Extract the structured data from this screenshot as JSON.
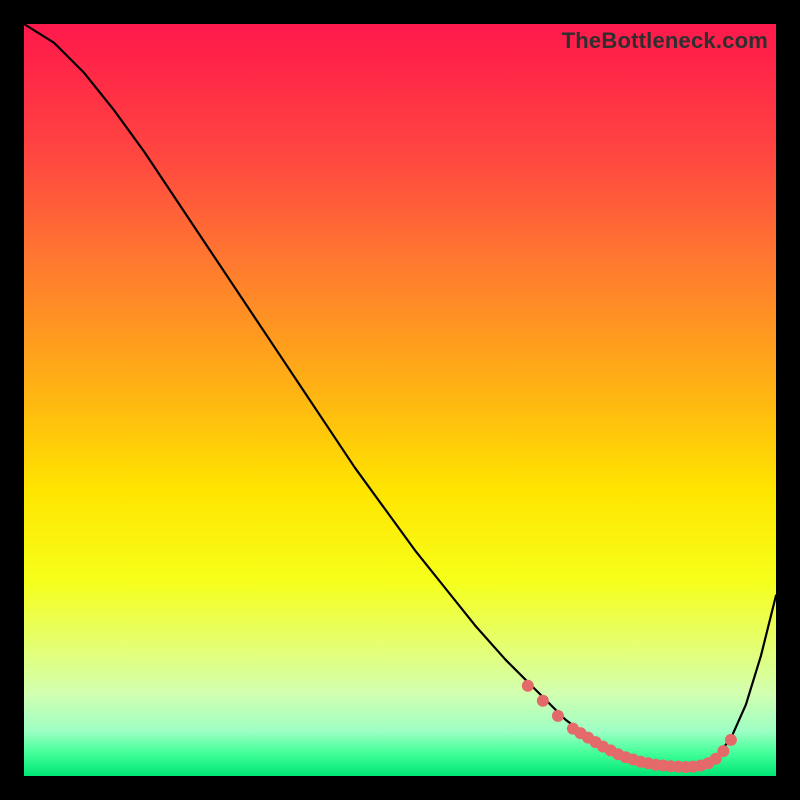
{
  "watermark": "TheBottleneck.com",
  "chart_data": {
    "type": "line",
    "title": "",
    "xlabel": "",
    "ylabel": "",
    "xlim": [
      0,
      100
    ],
    "ylim": [
      0,
      100
    ],
    "series": [
      {
        "name": "curve",
        "x": [
          0,
          4,
          8,
          12,
          16,
          20,
          24,
          28,
          32,
          36,
          40,
          44,
          48,
          52,
          56,
          60,
          64,
          68,
          72,
          74,
          76,
          78,
          80,
          82,
          84,
          86,
          88,
          90,
          92,
          94,
          96,
          98,
          100
        ],
        "y": [
          100,
          97.5,
          93.5,
          88.5,
          83,
          77,
          71,
          65,
          59,
          53,
          47,
          41,
          35.5,
          30,
          25,
          20,
          15.5,
          11.5,
          7.5,
          6,
          4.5,
          3.3,
          2.4,
          1.8,
          1.4,
          1.2,
          1.2,
          1.5,
          2.5,
          5,
          9.5,
          16,
          24
        ]
      }
    ],
    "markers": {
      "name": "highlight-points",
      "x": [
        67,
        69,
        71,
        73,
        74,
        75,
        76,
        77,
        78,
        79,
        80,
        81,
        82,
        83,
        84,
        85,
        86,
        87,
        88,
        89,
        90,
        91,
        92,
        93,
        94
      ],
      "y": [
        12,
        10,
        8,
        6.3,
        5.7,
        5.1,
        4.5,
        3.9,
        3.4,
        2.9,
        2.5,
        2.2,
        1.9,
        1.7,
        1.5,
        1.4,
        1.3,
        1.25,
        1.2,
        1.25,
        1.4,
        1.7,
        2.3,
        3.3,
        4.8
      ]
    }
  }
}
